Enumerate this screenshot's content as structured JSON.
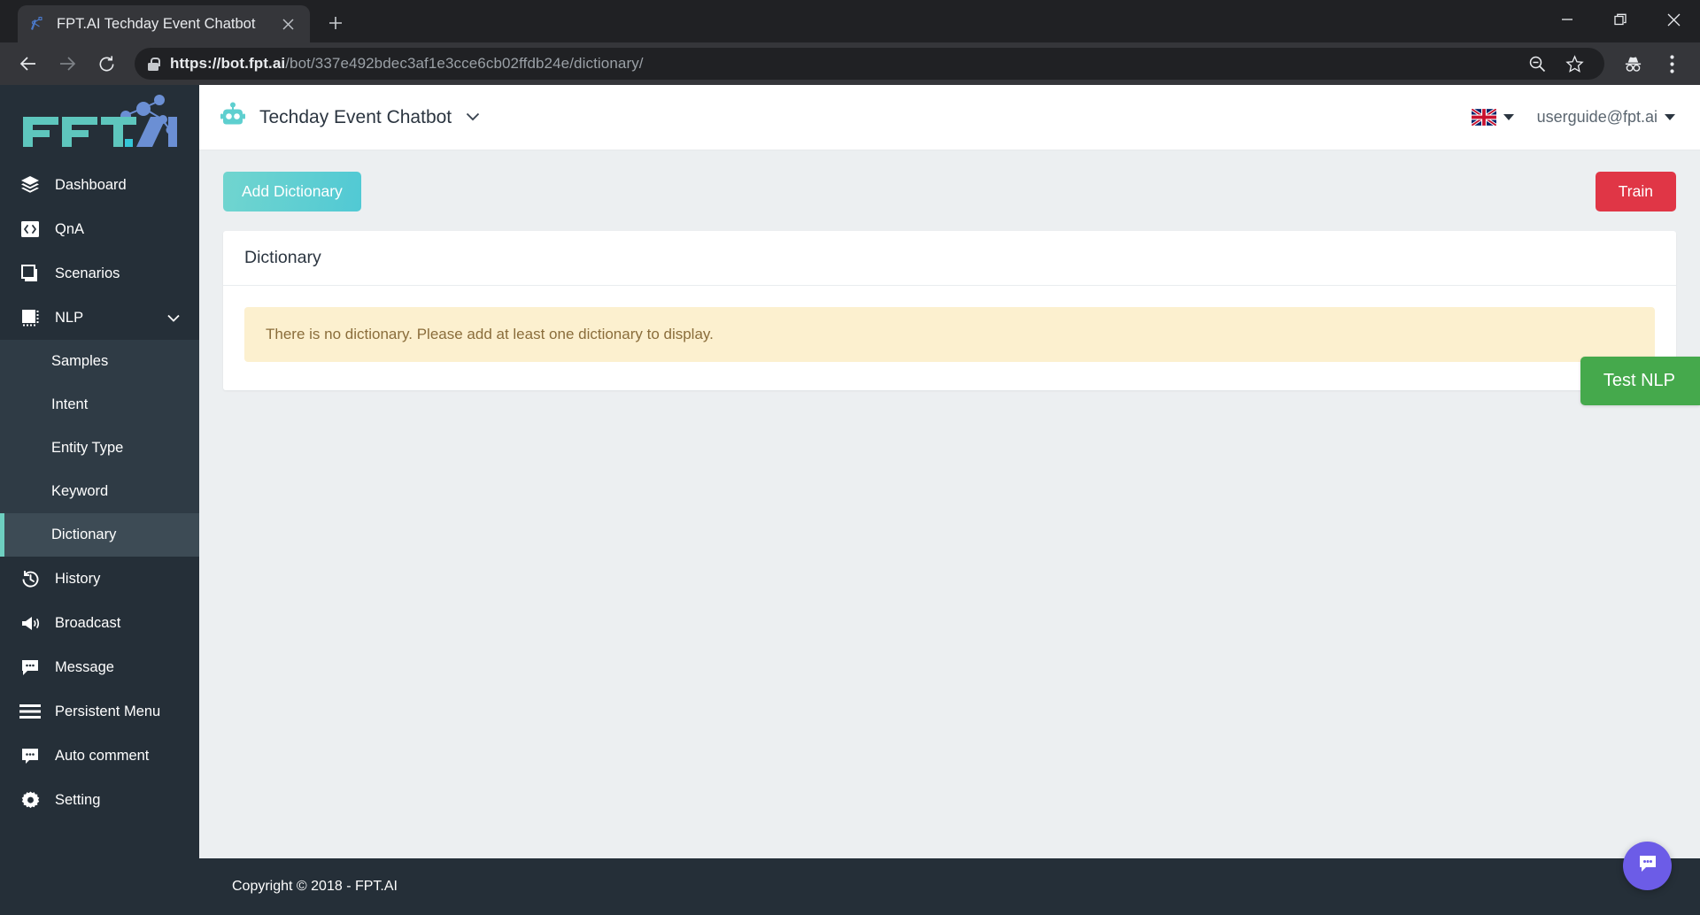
{
  "browser": {
    "tab": {
      "title": "FPT.AI Techday Event Chatbot",
      "favicon_icon": "fpt-ai-favicon",
      "close_icon": "close-icon"
    },
    "new_tab_label": "+",
    "window_controls": {
      "minimize": "minimize-icon",
      "maximize": "maximize-icon",
      "close": "close-icon"
    },
    "nav": {
      "back": "back-arrow-icon",
      "forward": "forward-arrow-icon",
      "reload": "reload-icon"
    },
    "omnibox": {
      "security_icon": "lock-icon",
      "url_scheme_host": "https://bot.fpt.ai",
      "url_path": "/bot/337e492bdec3af1e3cce6cb02ffdb24e/dictionary/",
      "full_url": "https://bot.fpt.ai/bot/337e492bdec3af1e3cce6cb02ffdb24e/dictionary/"
    },
    "actions": [
      "zoom-out-icon",
      "bookmark-star-icon",
      "incognito-icon",
      "more-menu-icon"
    ]
  },
  "sidebar": {
    "logo_text": "FPT.AI",
    "items": [
      {
        "label": "Dashboard",
        "icon": "layers-icon",
        "active": false
      },
      {
        "label": "QnA",
        "icon": "code-brackets-icon",
        "active": false
      },
      {
        "label": "Scenarios",
        "icon": "copy-windows-icon",
        "active": false
      },
      {
        "label": "NLP",
        "icon": "chip-icon",
        "active": false,
        "expanded": true,
        "caret": "chevron-down-icon"
      }
    ],
    "nlp_submenu": [
      {
        "label": "Samples",
        "active": false
      },
      {
        "label": "Intent",
        "active": false
      },
      {
        "label": "Entity Type",
        "active": false
      },
      {
        "label": "Keyword",
        "active": false
      },
      {
        "label": "Dictionary",
        "active": true
      }
    ],
    "items_bottom": [
      {
        "label": "History",
        "icon": "history-clock-icon"
      },
      {
        "label": "Broadcast",
        "icon": "megaphone-icon"
      },
      {
        "label": "Message",
        "icon": "message-bubble-icon"
      },
      {
        "label": "Persistent Menu",
        "icon": "hamburger-lines-icon"
      },
      {
        "label": "Auto comment",
        "icon": "comment-bubble-icon"
      },
      {
        "label": "Setting",
        "icon": "gear-icon"
      }
    ],
    "active_accent": "#6ecfc0"
  },
  "topbar": {
    "bot_icon": "robot-icon",
    "bot_name": "Techday Event Chatbot",
    "bot_caret": "chevron-down-icon",
    "language_flag": "uk-flag-icon",
    "language_caret": "caret-down-icon",
    "user_email": "userguide@fpt.ai",
    "user_caret": "caret-down-icon"
  },
  "main": {
    "add_dictionary_label": "Add Dictionary",
    "train_label": "Train",
    "card_title": "Dictionary",
    "empty_message": "There is no dictionary. Please add at least one dictionary to display.",
    "test_nlp_label": "Test NLP",
    "colors": {
      "add_button": "#5fcfd0",
      "train_button": "#e03646",
      "test_nlp": "#45a94c",
      "alert_bg": "#fcf0cf",
      "alert_text": "#8a6d3b"
    }
  },
  "footer": {
    "copyright": "Copyright © 2018 - FPT.AI"
  },
  "chat_widget": {
    "icon": "chat-bubble-icon",
    "color": "#6c5ce7"
  }
}
